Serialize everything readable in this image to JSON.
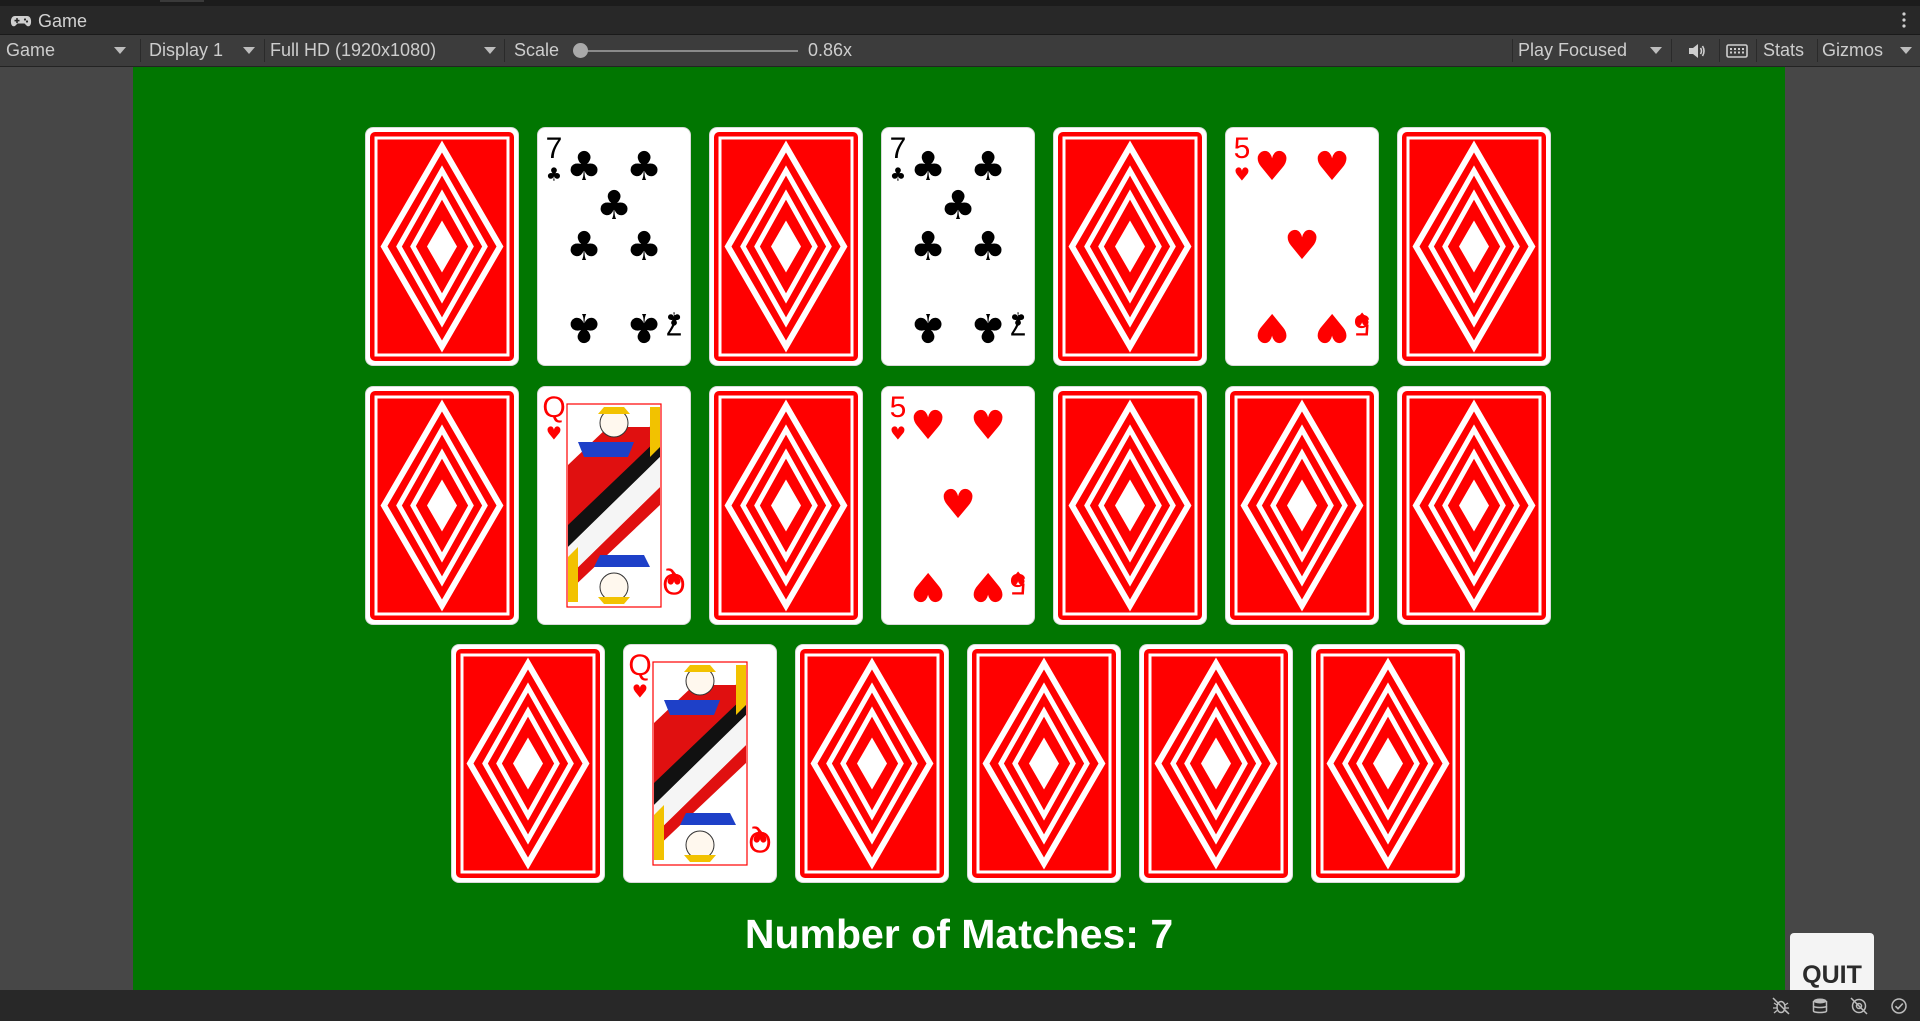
{
  "window": {
    "tab_title": "Game",
    "tab_icon": "gamepad-icon"
  },
  "toolbar": {
    "view_mode": "Game",
    "display": "Display 1",
    "resolution": "Full HD (1920x1080)",
    "scale_label": "Scale",
    "scale_value": "0.86x",
    "scale_level": 0.0,
    "play_mode": "Play Focused",
    "mute_icon": "speaker-icon",
    "keyboard_icon": "keyboard-icon",
    "stats_label": "Stats",
    "gizmos_label": "Gizmos"
  },
  "game": {
    "background_color": "#017601",
    "card_back_color": "#ff0000",
    "rows": [
      [
        {
          "face": "back"
        },
        {
          "face": "up",
          "rank": "7",
          "suit": "clubs",
          "suit_symbol": "♣",
          "color": "#000000"
        },
        {
          "face": "back"
        },
        {
          "face": "up",
          "rank": "7",
          "suit": "clubs",
          "suit_symbol": "♣",
          "color": "#000000"
        },
        {
          "face": "back"
        },
        {
          "face": "up",
          "rank": "5",
          "suit": "hearts",
          "suit_symbol": "♥",
          "color": "#ff0000"
        },
        {
          "face": "back"
        }
      ],
      [
        {
          "face": "back"
        },
        {
          "face": "up",
          "rank": "Q",
          "suit": "hearts",
          "suit_symbol": "♥",
          "color": "#ff0000"
        },
        {
          "face": "back"
        },
        {
          "face": "up",
          "rank": "5",
          "suit": "hearts",
          "suit_symbol": "♥",
          "color": "#ff0000"
        },
        {
          "face": "back"
        },
        {
          "face": "back"
        },
        {
          "face": "back"
        }
      ],
      [
        {
          "face": "back"
        },
        {
          "face": "up",
          "rank": "Q",
          "suit": "hearts",
          "suit_symbol": "♥",
          "color": "#ff0000"
        },
        {
          "face": "back"
        },
        {
          "face": "back"
        },
        {
          "face": "back"
        },
        {
          "face": "back"
        }
      ]
    ],
    "matches_text": "Number of Matches: 7",
    "quit_label": "QUIT"
  },
  "statusbar": {
    "icons": [
      "bug-off-icon",
      "database-icon",
      "target-off-icon",
      "check-circle-icon"
    ]
  }
}
